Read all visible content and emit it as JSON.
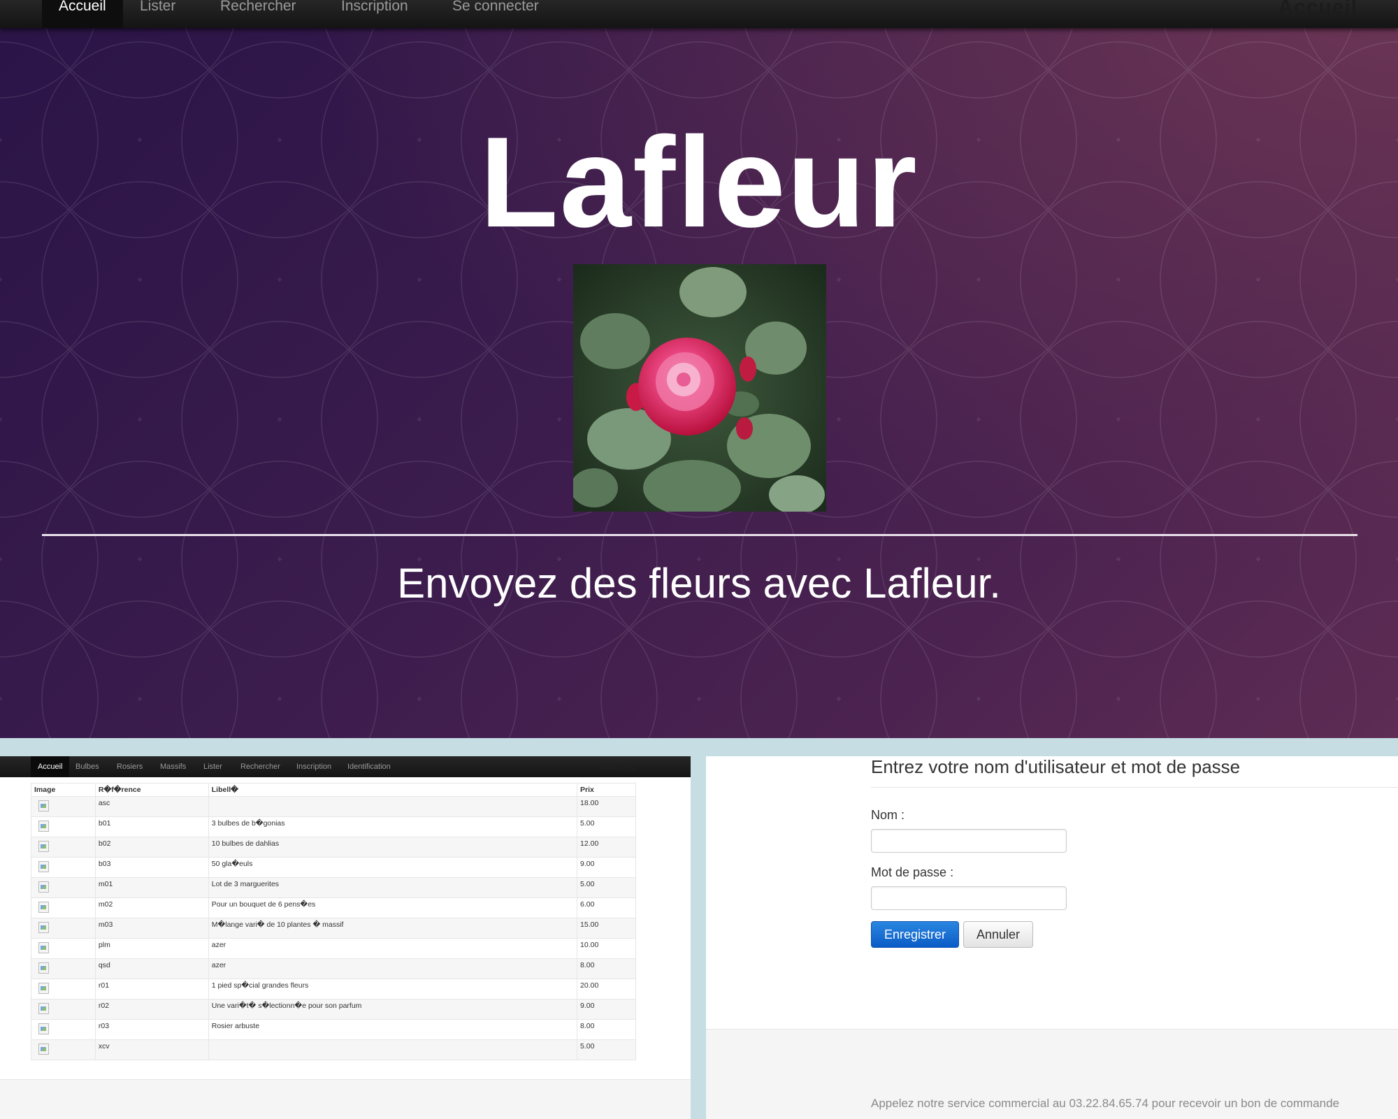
{
  "hero": {
    "nav": {
      "items": [
        "Accueil",
        "Lister",
        "Rechercher",
        "Inscription",
        "Se connecter"
      ],
      "active": "Accueil",
      "brand": "Accueil"
    },
    "title": "Lafleur",
    "image_icon": "rose-photo",
    "tagline": "Envoyez des fleurs avec Lafleur."
  },
  "products_page": {
    "nav": {
      "items": [
        "Accueil",
        "Bulbes",
        "Rosiers",
        "Massifs",
        "Lister",
        "Rechercher",
        "Inscription",
        "Identification"
      ],
      "active": "Accueil",
      "brand": "Accueil"
    },
    "table": {
      "headers": [
        "Image",
        "R�f�rence",
        "Libell�",
        "Prix"
      ],
      "rows": [
        {
          "ref": "asc",
          "label": "",
          "price": "18.00"
        },
        {
          "ref": "b01",
          "label": "3 bulbes de b�gonias",
          "price": "5.00"
        },
        {
          "ref": "b02",
          "label": "10 bulbes de dahlias",
          "price": "12.00"
        },
        {
          "ref": "b03",
          "label": "50 gla�euls",
          "price": "9.00"
        },
        {
          "ref": "m01",
          "label": "Lot de 3 marguerites",
          "price": "5.00"
        },
        {
          "ref": "m02",
          "label": "Pour un bouquet de 6 pens�es",
          "price": "6.00"
        },
        {
          "ref": "m03",
          "label": "M�lange vari� de 10 plantes � massif",
          "price": "15.00"
        },
        {
          "ref": "plm",
          "label": "azer",
          "price": "10.00"
        },
        {
          "ref": "qsd",
          "label": "azer",
          "price": "8.00"
        },
        {
          "ref": "r01",
          "label": "1 pied sp�cial grandes fleurs",
          "price": "20.00"
        },
        {
          "ref": "r02",
          "label": "Une vari�t� s�lectionn�e pour son parfum",
          "price": "9.00"
        },
        {
          "ref": "r03",
          "label": "Rosier arbuste",
          "price": "8.00"
        },
        {
          "ref": "xcv",
          "label": "",
          "price": "5.00"
        }
      ]
    }
  },
  "login_page": {
    "title": "Entrez votre nom d'utilisateur et mot de passe",
    "name_label": "Nom :",
    "name_value": "",
    "password_label": "Mot de passe :",
    "password_value": "",
    "save_label": "Enregistrer",
    "cancel_label": "Annuler",
    "footer_text": "Appelez notre service commercial au 03.22.84.65.74 pour recevoir un bon de commande"
  },
  "colors": {
    "hero_bg": "#3b1c4d",
    "nav_bg": "#1c1c1c",
    "primary_button": "#0a5cc6",
    "frame_bg": "#c5dde3"
  }
}
